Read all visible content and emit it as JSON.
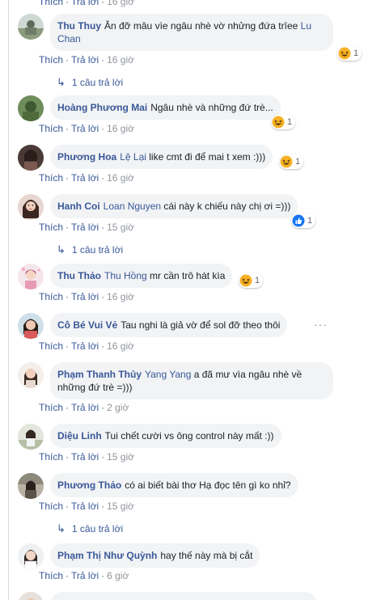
{
  "labels": {
    "like": "Thích",
    "reply": "Trả lời",
    "dot": "·"
  },
  "comments": [
    {
      "author": "Thu Thuy",
      "mention": "",
      "text": "Ăn đỡ mâu vìe ngâu nhè vờ nhửng đứa trîee",
      "trailing_mention": "Lu Chan",
      "time": "16 giờ",
      "reaction_count": "1",
      "replies": "1 câu trả lời"
    },
    {
      "author": "Hoàng Phương Mai",
      "mention": "",
      "text": "Ngâu nhè và những đứ trè...",
      "time": "16 giờ",
      "reaction_count": "1"
    },
    {
      "author": "Phương Hoa",
      "mention": "Lệ Lại",
      "text": "like cmt đi để mai t xem :)))",
      "time": "16 giờ",
      "reaction_count": "1"
    },
    {
      "author": "Hanh Coi",
      "mention": "Loan Nguyen",
      "text": "cái này k chiếu này chị ơi =)))",
      "time": "15 giờ",
      "reaction_count": "1",
      "replies": "1 câu trả lời"
    },
    {
      "author": "Thu Thảo",
      "mention": "Thu Hồng",
      "text": "mr cần trô hát kìa",
      "time": "16 giờ",
      "reaction_count": "1"
    },
    {
      "author": "Cô Bé Vui Vẻ",
      "mention": "",
      "text": "Tau nghi là giả vờ để sol đỡ theo thôi",
      "time": "16 giờ",
      "more": "···"
    },
    {
      "author": "Phạm Thanh Thủy",
      "mention": "Yang Yang",
      "text": "a đã mư vìa ngâu nhè về",
      "text2": "những đứ trè =)))",
      "time": "2 giờ"
    },
    {
      "author": "Diệu Linh",
      "mention": "",
      "text": "Tui chết cười vs ông control này mất :))",
      "time": "15 giờ"
    },
    {
      "author": "Phương Thảo",
      "mention": "",
      "text": "có ai biết bài thơ Hạ đọc tên gì ko nhỉ?",
      "time": "15 giờ",
      "replies": "1 câu trả lời"
    },
    {
      "author": "Phạm Thị Như Quỳnh",
      "mention": "",
      "text": "hay thế này mà bị cắt",
      "time": "6 giờ"
    }
  ],
  "top_partial": {
    "time": "16 giờ"
  },
  "colors": {
    "link": "#385898",
    "bubble": "#f2f3f5",
    "meta": "#606770",
    "like_blue": "#1877f2",
    "haha_yellow": "#f7b125"
  },
  "icons": [
    "haha-emoji-icon",
    "like-thumb-icon",
    "reply-arrow-icon",
    "more-dots-icon"
  ]
}
